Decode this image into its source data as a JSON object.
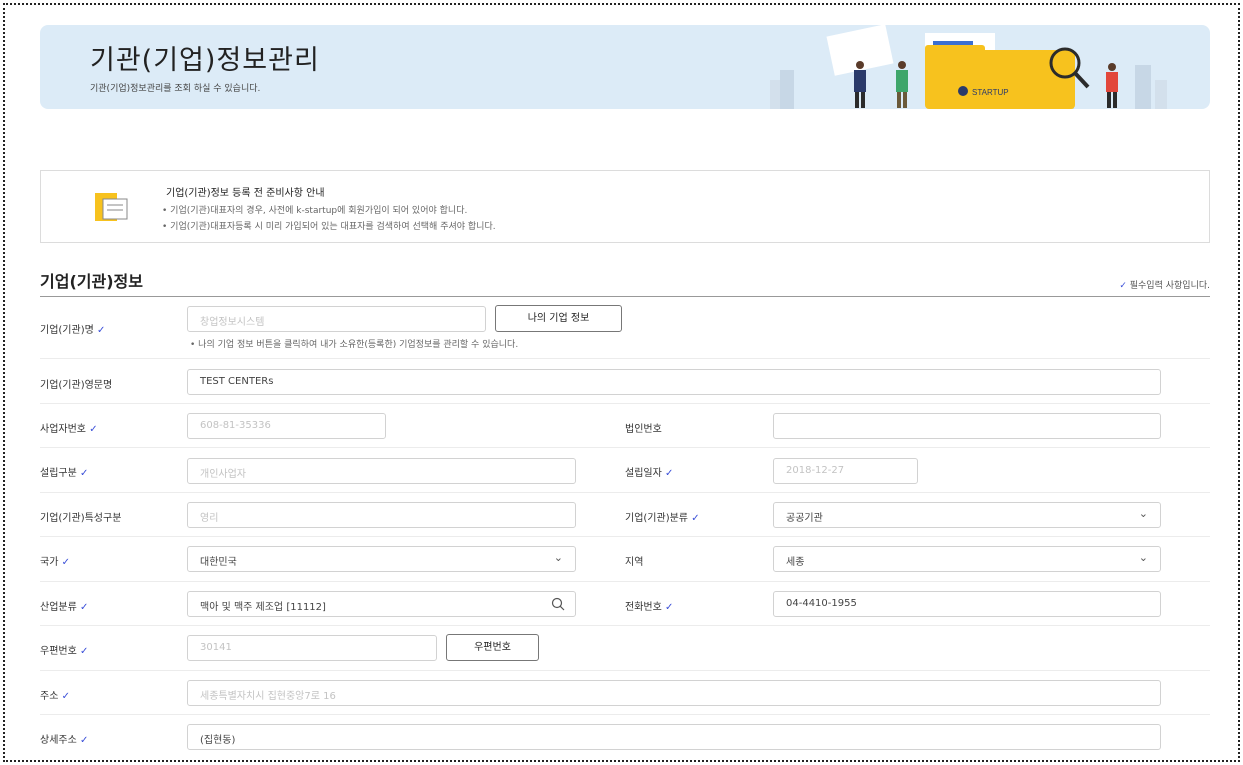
{
  "banner": {
    "title": "기관(기업)정보관리",
    "description": "기관(기업)정보관리를 조회 하실 수 있습니다.",
    "logo_text": "STARTUP"
  },
  "guide": {
    "title": "기업(기관)정보 등록 전 준비사항 안내",
    "lines": [
      "• 기업(기관)대표자의 경우, 사전에 k-startup에 회원가입이 되어 있어야 합니다.",
      "• 기업(기관)대표자등록 시 미리 가입되어 있는 대표자를 검색하여 선택해 주셔야 합니다."
    ]
  },
  "section": {
    "title": "기업(기관)정보",
    "required_note": "필수입력 사항입니다.",
    "check_mark": "✓"
  },
  "form": {
    "company_name": {
      "label": "기업(기관)명",
      "placeholder": "창업정보시스템",
      "button": "나의 기업 정보",
      "hint": "• 나의 기업 정보 버튼을 클릭하여 내가 소유한(등록한) 기업정보를 관리할 수 있습니다."
    },
    "english_name": {
      "label": "기업(기관)영문명",
      "value": "TEST CENTERs"
    },
    "business_number": {
      "label": "사업자번호",
      "value": "608-81-35336"
    },
    "corporate_number": {
      "label": "법인번호",
      "value": ""
    },
    "establishment_type": {
      "label": "설립구분",
      "value": "개인사업자"
    },
    "establishment_date": {
      "label": "설립일자",
      "value": "2018-12-27"
    },
    "characteristic_type": {
      "label": "기업(기관)특성구분",
      "value": "영리"
    },
    "classification": {
      "label": "기업(기관)분류",
      "value": "공공기관"
    },
    "country": {
      "label": "국가",
      "value": "대한민국"
    },
    "region": {
      "label": "지역",
      "value": "세종"
    },
    "industry": {
      "label": "산업분류",
      "value": "맥아 및 맥주 제조업 [11112]"
    },
    "phone": {
      "label": "전화번호",
      "value": "04-4410-1955"
    },
    "postal_code": {
      "label": "우편번호",
      "value": "30141",
      "button": "우편번호"
    },
    "address": {
      "label": "주소",
      "value": "세종특별자치시 집현중앙7로 16"
    },
    "detail_address": {
      "label": "상세주소",
      "value": "(집현동)"
    }
  },
  "icons": {
    "dropdown": "chevron-down-icon",
    "search": "search-icon",
    "check": "check-icon",
    "document": "document-icon"
  },
  "colors": {
    "banner_bg": "#dcebf7",
    "check": "#3a4fd8",
    "logo_yellow": "#f7c21e"
  }
}
